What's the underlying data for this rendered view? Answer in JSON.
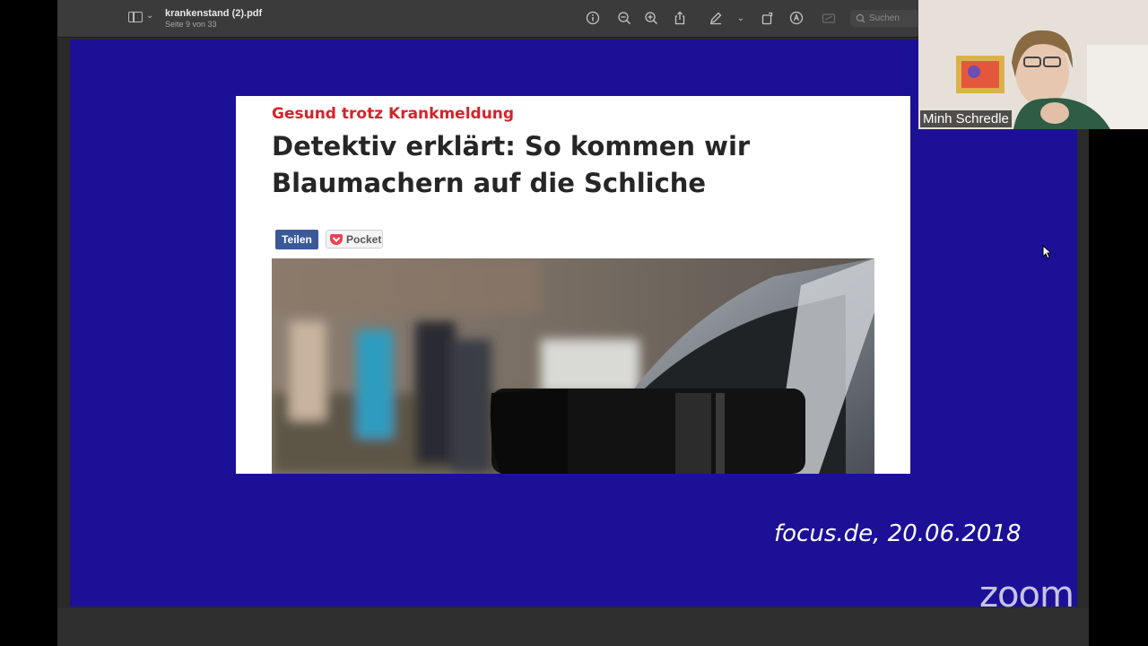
{
  "viewer": {
    "document_title": "krankenstand (2).pdf",
    "page_indicator": "Seite 9 von 33",
    "search_placeholder": "Suchen",
    "icons": [
      "sidebar-icon",
      "chevron-down-icon",
      "info-icon",
      "zoom-out-icon",
      "zoom-in-icon",
      "share-icon",
      "markup-pen-icon",
      "chevron-down-icon",
      "rotate-icon",
      "highlight-icon",
      "form-icon",
      "search-icon"
    ]
  },
  "slide": {
    "background_color": "#1c1196",
    "article": {
      "kicker": "Gesund trotz Krankmeldung",
      "headline": "Detektiv erklärt: So kommen wir Blaumachern auf die Schliche",
      "share_button": "Teilen",
      "pocket_button": "Pocket"
    },
    "caption": "focus.de, 20.06.2018"
  },
  "zoom": {
    "participant_name": "Minh Schredle",
    "logo_text": "zoom"
  }
}
